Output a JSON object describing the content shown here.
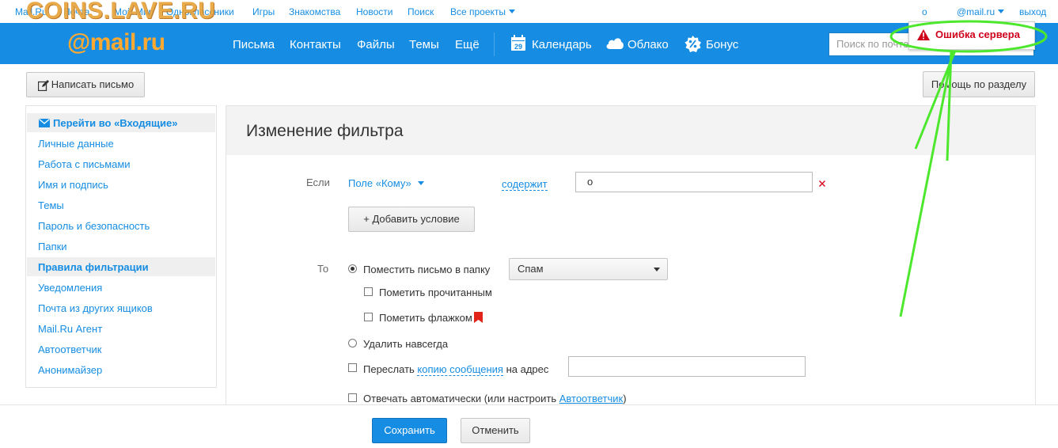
{
  "portal": {
    "watermark": "COINS.LAVE.RU",
    "links": [
      "Mail.Ru",
      "Почта",
      "Мой Мир",
      "Одноклассники",
      "Игры",
      "Знакомства",
      "Новости",
      "Поиск"
    ],
    "all_projects": "Все проекты",
    "user_initial": "о",
    "user_email": "@mail.ru",
    "logout": "выход"
  },
  "header": {
    "logo": "@mail.ru",
    "nav": [
      "Письма",
      "Контакты",
      "Файлы",
      "Темы",
      "Ещё"
    ],
    "calendar": "Календарь",
    "calendar_day": "29",
    "cloud": "Облако",
    "bonus": "Бонус",
    "search_placeholder": "Поиск по почте"
  },
  "error_popup": {
    "text": "Ошибка сервера"
  },
  "toolbar": {
    "compose": "Написать письмо",
    "help": "Помощь по разделу"
  },
  "sidebar": {
    "inbox": "Перейти во «Входящие»",
    "items": [
      "Личные данные",
      "Работа с письмами",
      "Имя и подпись",
      "Темы",
      "Пароль и безопасность",
      "Папки",
      "Правила фильтрации",
      "Уведомления",
      "Почта из других ящиков",
      "Mail.Ru Агент",
      "Автоответчик",
      "Анонимайзер"
    ],
    "active_index": 6
  },
  "filter": {
    "title": "Изменение фильтра",
    "if_label": "Если",
    "field_select": "Поле «Кому»",
    "condition": "содержит",
    "condition_value": "о",
    "add_condition": "+ Добавить условие",
    "then_label": "То",
    "move_to_folder": "Поместить письмо в папку",
    "folder_value": "Спам",
    "mark_read": "Пометить прочитанным",
    "mark_flag": "Пометить флажком",
    "delete_forever": "Удалить навсегда",
    "forward_prefix": "Переслать",
    "forward_link": "копию сообщения",
    "forward_suffix": "на адрес",
    "autoreply_prefix": "Отвечать автоматически (или настроить",
    "autoreply_link": "Автоответчик",
    "autoreply_suffix": ")"
  },
  "footer": {
    "save": "Сохранить",
    "cancel": "Отменить"
  },
  "colors": {
    "brand_blue": "#168de2",
    "logo_orange": "#ffa930",
    "error_red": "#d0021b",
    "annotation_green": "#4de82e",
    "watermark": "#e8a33b"
  }
}
